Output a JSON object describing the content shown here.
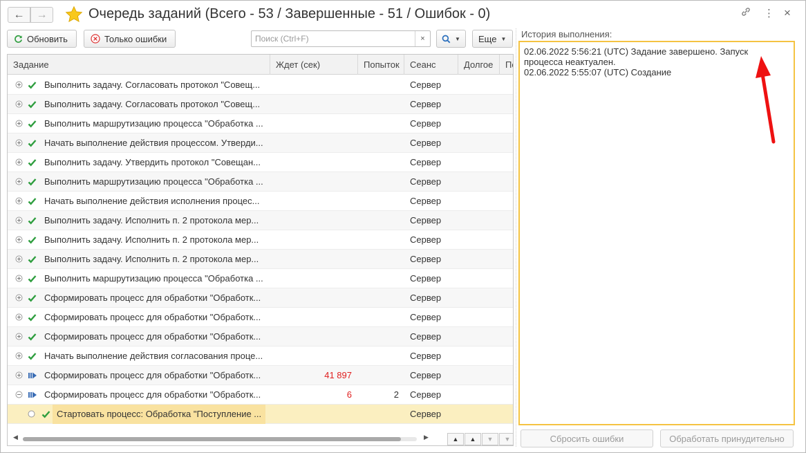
{
  "window": {
    "title": "Очередь заданий (Всего - 53 / Завершенные - 51 / Ошибок - 0)",
    "controls": {
      "link": "🔗",
      "more": "⋮",
      "close": "×"
    }
  },
  "toolbar": {
    "refresh_label": "Обновить",
    "errors_only_label": "Только ошибки",
    "search_placeholder": "Поиск (Ctrl+F)",
    "search_clear": "×",
    "more_label": "Еще"
  },
  "table": {
    "columns": [
      {
        "label": "Задание"
      },
      {
        "label": "Ждет (сек)"
      },
      {
        "label": "Попыток"
      },
      {
        "label": "Сеанс"
      },
      {
        "label": "Долгое"
      },
      {
        "label": "По"
      }
    ],
    "rows": [
      {
        "status": "done",
        "expander": "plus",
        "task": "Выполнить задачу. Согласовать протокол \"Совещ...",
        "wait": "",
        "attempts": "",
        "session": "Сервер"
      },
      {
        "status": "done",
        "expander": "plus",
        "task": "Выполнить задачу. Согласовать протокол \"Совещ...",
        "wait": "",
        "attempts": "",
        "session": "Сервер"
      },
      {
        "status": "done",
        "expander": "plus",
        "task": "Выполнить маршрутизацию процесса \"Обработка ...",
        "wait": "",
        "attempts": "",
        "session": "Сервер"
      },
      {
        "status": "done",
        "expander": "plus",
        "task": "Начать выполнение действия процессом. Утверди...",
        "wait": "",
        "attempts": "",
        "session": "Сервер"
      },
      {
        "status": "done",
        "expander": "plus",
        "task": "Выполнить задачу. Утвердить протокол \"Совещан...",
        "wait": "",
        "attempts": "",
        "session": "Сервер"
      },
      {
        "status": "done",
        "expander": "plus",
        "task": "Выполнить маршрутизацию процесса \"Обработка ...",
        "wait": "",
        "attempts": "",
        "session": "Сервер"
      },
      {
        "status": "done",
        "expander": "plus",
        "task": "Начать выполнение действия исполнения процес...",
        "wait": "",
        "attempts": "",
        "session": "Сервер"
      },
      {
        "status": "done",
        "expander": "plus",
        "task": "Выполнить задачу. Исполнить п. 2 протокола мер...",
        "wait": "",
        "attempts": "",
        "session": "Сервер"
      },
      {
        "status": "done",
        "expander": "plus",
        "task": "Выполнить задачу. Исполнить п. 2 протокола мер...",
        "wait": "",
        "attempts": "",
        "session": "Сервер"
      },
      {
        "status": "done",
        "expander": "plus",
        "task": "Выполнить задачу. Исполнить п. 2 протокола мер...",
        "wait": "",
        "attempts": "",
        "session": "Сервер"
      },
      {
        "status": "done",
        "expander": "plus",
        "task": "Выполнить маршрутизацию процесса \"Обработка ...",
        "wait": "",
        "attempts": "",
        "session": "Сервер"
      },
      {
        "status": "done",
        "expander": "plus",
        "task": "Сформировать процесс для обработки \"Обработк...",
        "wait": "",
        "attempts": "",
        "session": "Сервер"
      },
      {
        "status": "done",
        "expander": "plus",
        "task": "Сформировать процесс для обработки \"Обработк...",
        "wait": "",
        "attempts": "",
        "session": "Сервер"
      },
      {
        "status": "done",
        "expander": "plus",
        "task": "Сформировать процесс для обработки \"Обработк...",
        "wait": "",
        "attempts": "",
        "session": "Сервер"
      },
      {
        "status": "done",
        "expander": "plus",
        "task": "Начать выполнение действия согласования проце...",
        "wait": "",
        "attempts": "",
        "session": "Сервер"
      },
      {
        "status": "running",
        "expander": "plus",
        "task": "Сформировать процесс для обработки \"Обработк...",
        "wait": "41 897",
        "attempts": "",
        "session": "Сервер"
      },
      {
        "status": "running",
        "expander": "minus",
        "task": "Сформировать процесс для обработки \"Обработк...",
        "wait": "6",
        "attempts": "2",
        "session": "Сервер"
      },
      {
        "status": "done",
        "expander": "leaf",
        "task": "Стартовать процесс: Обработка \"Поступление ...",
        "wait": "",
        "attempts": "",
        "session": "Сервер",
        "selected": true
      }
    ]
  },
  "history": {
    "label": "История выполнения:",
    "lines": [
      "02.06.2022 5:56:21 (UTC) Задание завершено. Запуск процесса неактуален.",
      "02.06.2022 5:55:07 (UTC) Создание"
    ]
  },
  "buttons": {
    "reset_errors": "Сбросить ошибки",
    "force_process": "Обработать принудительно"
  },
  "colors": {
    "accent_border": "#f5c342",
    "check_green": "#2f9e3f",
    "wait_red": "#e02020",
    "selected_row": "#fbefc0",
    "annotation_arrow": "#ee1111"
  }
}
